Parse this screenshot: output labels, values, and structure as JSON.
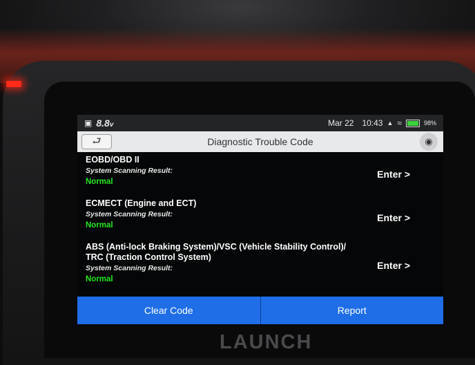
{
  "status_bar": {
    "voltage": "8.8",
    "voltage_unit": "v",
    "date": "Mar 22",
    "time": "10:43",
    "battery_percent": "98%",
    "battery_level": 0.98
  },
  "title_bar": {
    "title": "Diagnostic Trouble Code",
    "back_icon": "back-arrow-icon",
    "camera_icon": "camera-icon"
  },
  "systems": [
    {
      "title_line1": "EOBD/OBD II",
      "title_line2": "",
      "result_label": "System Scanning Result:",
      "status": "Normal",
      "action": "Enter >"
    },
    {
      "title_line1": "ECMECT (Engine and ECT)",
      "title_line2": "",
      "result_label": "System Scanning Result:",
      "status": "Normal",
      "action": "Enter >"
    },
    {
      "title_line1": "ABS (Anti-lock Braking System)/VSC (Vehicle Stability Control)/",
      "title_line2": "TRC (Traction Control System)",
      "result_label": "System Scanning Result:",
      "status": "Normal",
      "action": "Enter >"
    }
  ],
  "bottom_bar": {
    "clear_label": "Clear Code",
    "report_label": "Report"
  },
  "device": {
    "brand": "LAUNCH"
  },
  "colors": {
    "accent": "#1f6ee8",
    "status_normal": "#22e622",
    "title_bar_bg": "#e8e9eb",
    "led": "#ff2a1a"
  }
}
